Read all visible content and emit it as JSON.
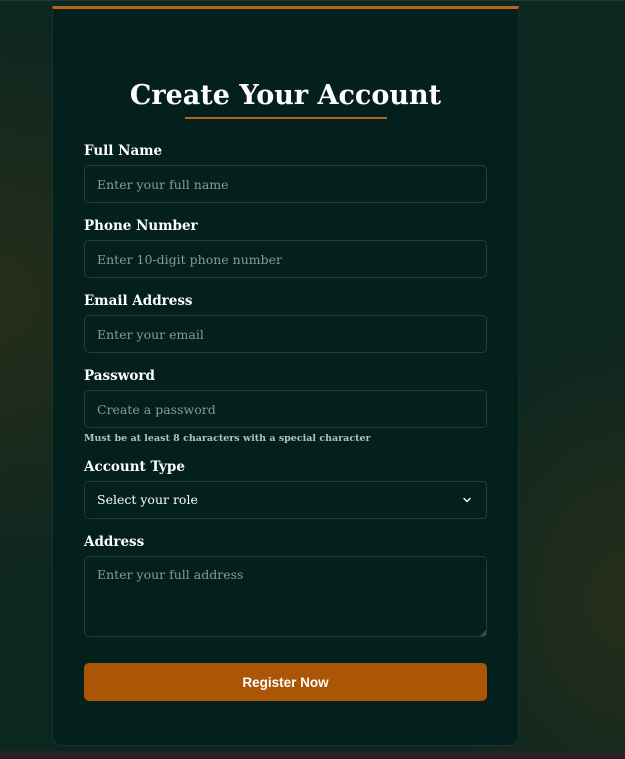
{
  "form": {
    "title": "Create Your Account",
    "fields": {
      "full_name": {
        "label": "Full Name",
        "placeholder": "Enter your full name",
        "value": ""
      },
      "phone": {
        "label": "Phone Number",
        "placeholder": "Enter 10-digit phone number",
        "value": ""
      },
      "email": {
        "label": "Email Address",
        "placeholder": "Enter your email",
        "value": ""
      },
      "password": {
        "label": "Password",
        "placeholder": "Create a password",
        "value": "",
        "hint": "Must be at least 8 characters with a special character"
      },
      "account_type": {
        "label": "Account Type",
        "selected": "Select your role"
      },
      "address": {
        "label": "Address",
        "placeholder": "Enter your full address",
        "value": ""
      }
    },
    "submit_label": "Register Now"
  },
  "icons": {
    "select_arrow": "chevron-down-icon"
  },
  "colors": {
    "accent": "#b8651a",
    "button": "#ad5506",
    "card_background": "#04201d",
    "page_background": "#0c2620"
  }
}
